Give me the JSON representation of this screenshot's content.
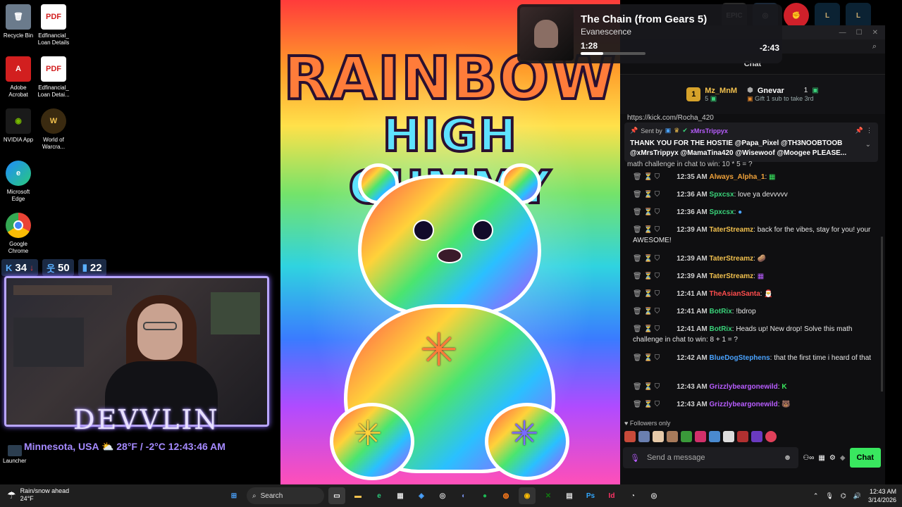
{
  "desktop": {
    "icons": [
      {
        "label": "Recycle Bin"
      },
      {
        "label": "Edfinancial_ Loan Details"
      },
      {
        "label": "Adobe Acrobat"
      },
      {
        "label": "Edfinancial_ Loan Detai..."
      },
      {
        "label": "NVIDIA App"
      },
      {
        "label": "World of Warcra..."
      },
      {
        "label": "Microsoft Edge"
      },
      {
        "label": "Google Chrome"
      }
    ],
    "launcher_label": "Launcher"
  },
  "stats": {
    "kick_count": "34",
    "followers": "50",
    "viewers": "22"
  },
  "overlay": {
    "brand": "DEVVLIN",
    "location": "Minnesota, USA",
    "weather": "28°F / -2°C",
    "time": "12:43:46 AM"
  },
  "art": {
    "line1": "RAINBOW",
    "line2": "HIGH GUMMY"
  },
  "media": {
    "title": "The Chain (from Gears 5)",
    "artist": "Evanescence",
    "elapsed": "1:28",
    "remaining": "-2:43",
    "progress": 0.35
  },
  "chat": {
    "header": "Chat",
    "leaderboard": {
      "first": {
        "rank": "1",
        "name": "Mz_MnM",
        "count": "5"
      },
      "second": {
        "name": "Gnevar",
        "count": "1",
        "note": "Gift 1 sub to take 3rd"
      }
    },
    "peek_top": "https://kick.com/Rocha_420",
    "pinned": {
      "sent_by": "Sent by",
      "user": "xMrsTrippyx",
      "text": "THANK YOU FOR THE HOSTIE @Papa_Pixel @TH3NOOBTOOB @xMrsTrippyx @MamaTina420 @Wisewoof @Moogee PLEASE..."
    },
    "peek_bottom": "math challenge in chat to win: 10 * 5 = ?",
    "messages": [
      {
        "time": "12:35 AM",
        "user": "Always_Alpha_1",
        "color": "#f2a33a",
        "text": ":"
      },
      {
        "time": "12:36 AM",
        "user": "Spxcsx",
        "color": "#3ad37a",
        "text": ": love ya devvvvv"
      },
      {
        "time": "12:36 AM",
        "user": "Spxcsx",
        "color": "#3ad37a",
        "text": ":"
      },
      {
        "time": "12:39 AM",
        "user": "TaterStreamz",
        "color": "#f2c14e",
        "text": ": back for the vibes, stay for you! your AWESOME!"
      },
      {
        "time": "12:39 AM",
        "user": "TaterStreamz",
        "color": "#f2c14e",
        "text": ":"
      },
      {
        "time": "12:39 AM",
        "user": "TaterStreamz",
        "color": "#f2c14e",
        "text": ":"
      },
      {
        "time": "12:41 AM",
        "user": "TheAsianSanta",
        "color": "#ff4d4d",
        "text": ":"
      },
      {
        "time": "12:41 AM",
        "user": "BotRix",
        "color": "#3ad37a",
        "text": ": !bdrop"
      },
      {
        "time": "12:41 AM",
        "user": "BotRix",
        "color": "#3ad37a",
        "text": ": Heads up! New drop! Solve this math challenge in chat to win: 8 + 1 = ?"
      },
      {
        "time": "12:42 AM",
        "user": "BlueDogStephens",
        "color": "#4aa3ff",
        "text": ": that the first time i heard of that"
      },
      {
        "time": "12:43 AM",
        "user": "Grizzlybeargonewild",
        "color": "#b85dff",
        "text": ":"
      },
      {
        "time": "12:43 AM",
        "user": "Grizzlybeargonewild",
        "color": "#b85dff",
        "text": ":"
      }
    ],
    "followers_only": "Followers only",
    "send_placeholder": "Send a message",
    "send_button": "Chat"
  },
  "taskbar": {
    "weather_title": "Rain/snow ahead",
    "weather_temp": "24°F",
    "search_label": "Search",
    "time": "12:43 AM",
    "date": "3/14/2026"
  }
}
